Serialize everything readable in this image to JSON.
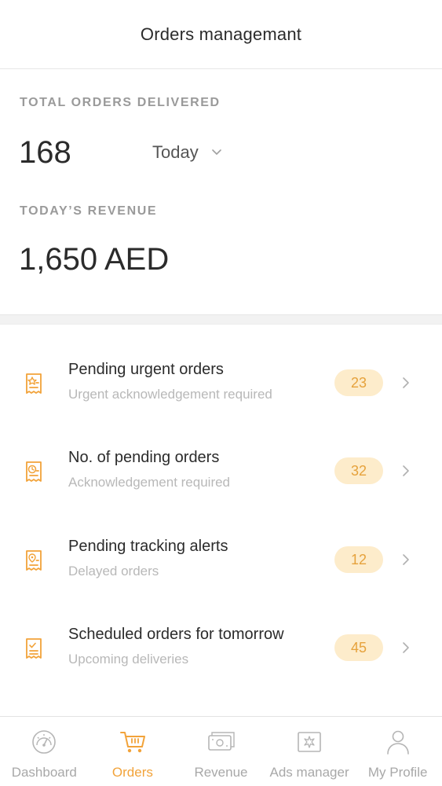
{
  "header": {
    "title": "Orders managemant"
  },
  "stats": {
    "delivered_label": "TOTAL ORDERS DELIVERED",
    "delivered_value": "168",
    "period_selected": "Today",
    "revenue_label": "TODAY’S REVENUE",
    "revenue_value": "1,650 AED"
  },
  "colors": {
    "accent": "#f2a33a",
    "badge_bg": "#fdeccb",
    "badge_text": "#e6a23c",
    "muted_text": "#b8b8b8"
  },
  "orders": [
    {
      "title": "Pending urgent orders",
      "subtitle": "Urgent acknowledgement required",
      "count": "23",
      "icon": "urgent-order-icon"
    },
    {
      "title": "No. of pending orders",
      "subtitle": "Acknowledgement required",
      "count": "32",
      "icon": "pending-order-icon"
    },
    {
      "title": "Pending tracking alerts",
      "subtitle": "Delayed orders",
      "count": "12",
      "icon": "tracking-alert-icon"
    },
    {
      "title": "Scheduled orders for tomorrow",
      "subtitle": "Upcoming deliveries",
      "count": "45",
      "icon": "scheduled-order-icon"
    }
  ],
  "tabs": [
    {
      "label": "Dashboard",
      "icon": "speedometer-icon",
      "active": false
    },
    {
      "label": "Orders",
      "icon": "cart-icon",
      "active": true
    },
    {
      "label": "Revenue",
      "icon": "cash-icon",
      "active": false
    },
    {
      "label": "Ads manager",
      "icon": "ads-icon",
      "active": false
    },
    {
      "label": "My Profile",
      "icon": "user-icon",
      "active": false
    }
  ]
}
